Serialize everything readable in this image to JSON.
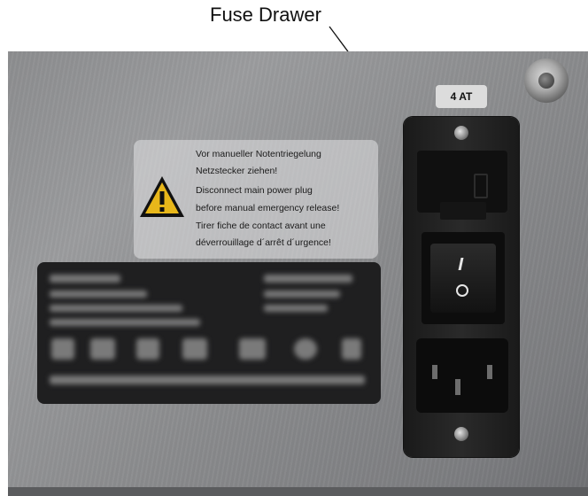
{
  "callout": {
    "label": "Fuse Drawer"
  },
  "fuse_rating": "4 AT",
  "warning_label": {
    "lines": [
      "Vor manueller Notentriegelung",
      "Netzstecker ziehen!",
      "Disconnect main power plug",
      "before manual emergency release!",
      "Tirer fiche de contact avant une",
      "déverrouillage d´arrêt d´urgence!"
    ]
  },
  "power_switch": {
    "on_symbol": "I",
    "off_symbol": "O"
  },
  "colors": {
    "panel": "#8c8d8f",
    "module": "#1a1a1a",
    "warning_yellow": "#e8b71a"
  }
}
